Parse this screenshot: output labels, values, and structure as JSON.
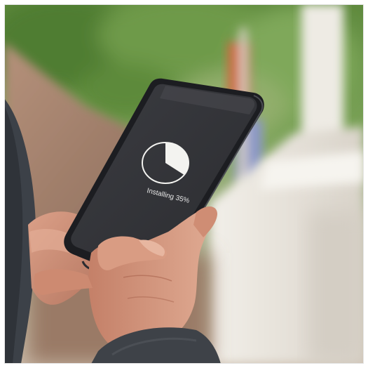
{
  "phone": {
    "status_text": "Installing 35%",
    "install_progress_percent": 35
  },
  "colors": {
    "screen": "#35363a",
    "phone_frame": "#1c1d21",
    "pie_fill": "#f3f3f0",
    "pie_outline": "#f3f3f0",
    "status_text": "#e8e8e8",
    "foliage": "#6f9a4b",
    "rail": "#e7e3dc",
    "skin": "#c88c73",
    "sleeve": "#3e4248"
  }
}
